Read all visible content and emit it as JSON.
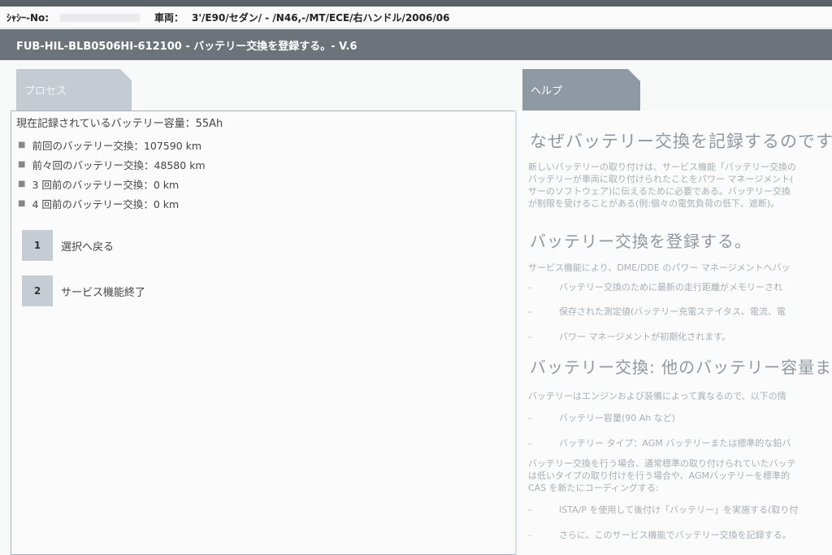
{
  "vehicle_bar": {
    "chassis_label": "ｼｬｼｰ-No:",
    "vehicle_label": "車両：",
    "vehicle_value": "3'/E90/セダン/ - /N46,-/MT/ECE/右ハンドル/2006/06"
  },
  "title": "FUB-HIL-BLB0506HI-612100 - バッテリー交換を登録する。- V.6",
  "tabs": {
    "process": "プロセス",
    "help": "ヘルプ"
  },
  "process": {
    "capacity": "現在記録されているバッテリー容量：55Ah",
    "history": [
      "前回のバッテリー交換：107590 km",
      "前々回のバッテリー交換：48580 km",
      "3 回前のバッテリー交換：0 km",
      "4 回前のバッテリー交換：0 km"
    ],
    "actions": [
      {
        "num": "1",
        "label": "選択へ戻る"
      },
      {
        "num": "2",
        "label": "サービス機能終了"
      }
    ]
  },
  "help": {
    "h1": "なぜバッテリー交換を記録するのです",
    "p1": [
      "新しいバッテリーの取り付けは、サービス機能「バッテリー交換の",
      "バッテリーが車両に取り付けられたことをパワー マネージメント(",
      "サーのソフトウェア)に伝えるために必要である。バッテリー交換",
      "が制限を受けることがある(例:個々の電気負荷の低下、遮断)。"
    ],
    "h2": "バッテリー交換を登録する。",
    "p2": "サービス機能により、DME/DDE のパワー マネージメントへバッ",
    "list2": [
      "バッテリー交換のために最新の走行距離がメモリーされ",
      "保存された測定値(バッテリー充電ステイタス、電流、電",
      "パワー マネージメントが初期化されます。"
    ],
    "h3": "バッテリー交換: 他のバッテリー容量ま",
    "p3": "バッテリーはエンジンおよび装備によって異なるので、以下の情",
    "list3": [
      "バッテリー容量(90 Ah など)",
      "バッテリー タイプ：AGM バッテリーまたは標準的な鉛バ"
    ],
    "p4": [
      "バッテリー交換を行う場合、通常標準の取り付けられていたバッテ",
      "は低いタイプの取り付けを行う場合や、AGMバッテリーを標準的",
      "CAS を新たにコーディングする:"
    ],
    "list4": [
      "ISTA/P を使用して後付け「バッテリー」を実施する(取り付",
      "さらに、このサービス機能でバッテリー交換を記録する。"
    ]
  }
}
